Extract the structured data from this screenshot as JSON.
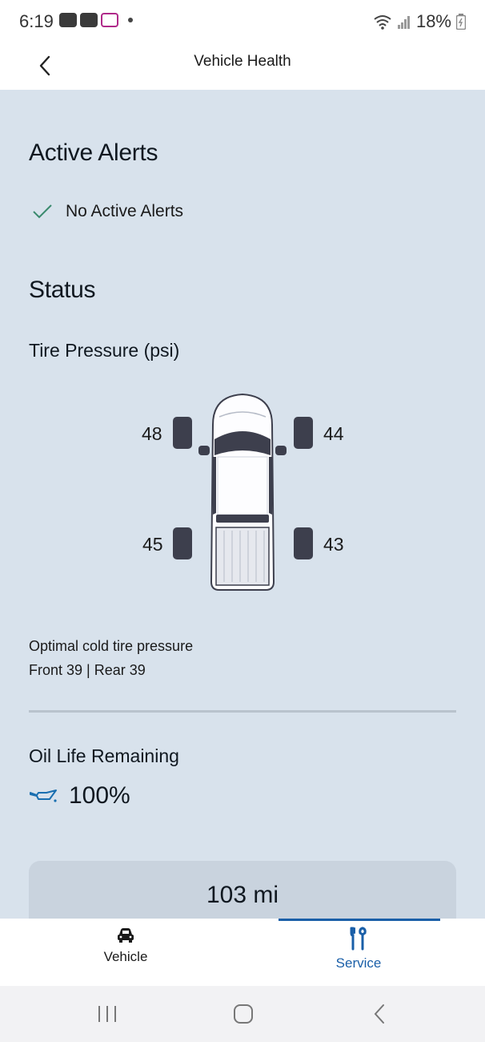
{
  "status_bar": {
    "time": "6:19",
    "battery": "18%"
  },
  "header": {
    "title": "Vehicle Health"
  },
  "alerts": {
    "heading": "Active Alerts",
    "message": "No Active Alerts"
  },
  "status": {
    "heading": "Status",
    "tire_pressure": {
      "heading": "Tire Pressure (psi)",
      "front_left": "48",
      "front_right": "44",
      "rear_left": "45",
      "rear_right": "43",
      "optimal_label": "Optimal cold tire pressure",
      "optimal_values": "Front 39 | Rear 39"
    },
    "oil": {
      "heading": "Oil Life Remaining",
      "value": "100%"
    },
    "mileage": "103 mi"
  },
  "bottom_nav": {
    "items": [
      {
        "label": "Vehicle",
        "icon": "car-icon",
        "active": false
      },
      {
        "label": "Service",
        "icon": "tools-icon",
        "active": true
      }
    ]
  },
  "colors": {
    "accent": "#1a5fa8",
    "background": "#d8e2ec",
    "tire": "#3d3f4d",
    "check": "#3a8a6e"
  }
}
